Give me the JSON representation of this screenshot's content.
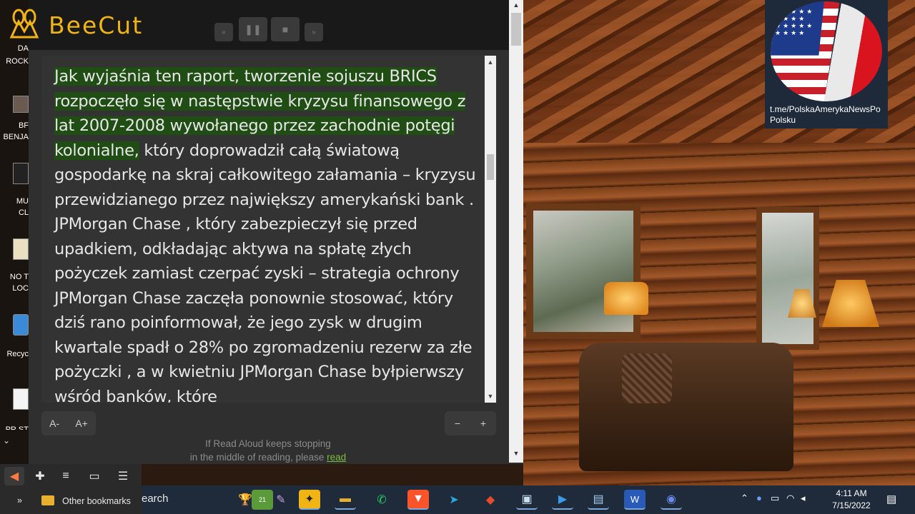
{
  "app": {
    "name": "BeeCut",
    "brand_color": "#f1b415",
    "highlight_color": "#1f4d14"
  },
  "player": {
    "rewind_icon": "rewind-icon",
    "pause_icon": "pause-icon",
    "stop_icon": "stop-icon",
    "forward_icon": "fast-forward-icon"
  },
  "reader": {
    "highlighted_text": "Jak wyjaśnia ten raport, tworzenie sojuszu BRICS rozpoczęło się w następstwie kryzysu finansowego z lat 2007-2008 wywołanego przez zachodnie potęgi kolonialne,",
    "rest_text": " który doprowadził całą światową gospodarkę na skraj całkowitego załamania – kryzysu przewidzianego przez największy amerykański bank . JPMorgan Chase , który zabezpieczył się przed upadkiem, odkładając aktywa na spłatę złych pożyczek zamiast czerpać zyski – strategia ochrony JPMorgan Chase zaczęła ponownie stosować, który dziś rano poinformował, że jego zysk w drugim kwartale spadł o 28% po zgromadzeniu rezerw za złe pożyczki , a w kwietniu JPMorgan Chase byłpierwszy wśród banków, które",
    "font_decrease": "A-",
    "font_increase": "A+",
    "speed_decrease": "−",
    "speed_increase": "+",
    "note_line1": "If Read Aloud keeps stopping",
    "note_line2": "in the middle of reading, please",
    "note_link": "read"
  },
  "desktop": {
    "items": [
      "DA",
      "ROCK",
      "BF",
      "BENJA",
      "MU",
      "CL",
      "NO T",
      "LOC",
      "Recyc",
      "PR ST"
    ]
  },
  "widget": {
    "caption": "t.me/PolskaAmerykaNewsPo Polsku"
  },
  "browser": {
    "bookmarks_chevron": "»",
    "bookmarks_folder": "Other bookmarks"
  },
  "taskbar": {
    "search_text": "earch",
    "badge_count": "21",
    "time": "4:11 AM",
    "date": "7/15/2022"
  }
}
